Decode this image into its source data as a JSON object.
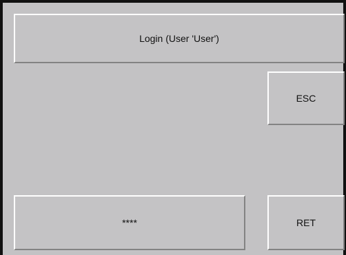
{
  "dialog": {
    "title": "Login (User 'User')"
  },
  "buttons": {
    "esc_label": "ESC",
    "ret_label": "RET"
  },
  "password": {
    "value": "****"
  },
  "colors": {
    "background": "#c3c2c4",
    "frame": "#111111",
    "highlight": "#ffffff",
    "shadow": "#838383",
    "text": "#111111"
  }
}
